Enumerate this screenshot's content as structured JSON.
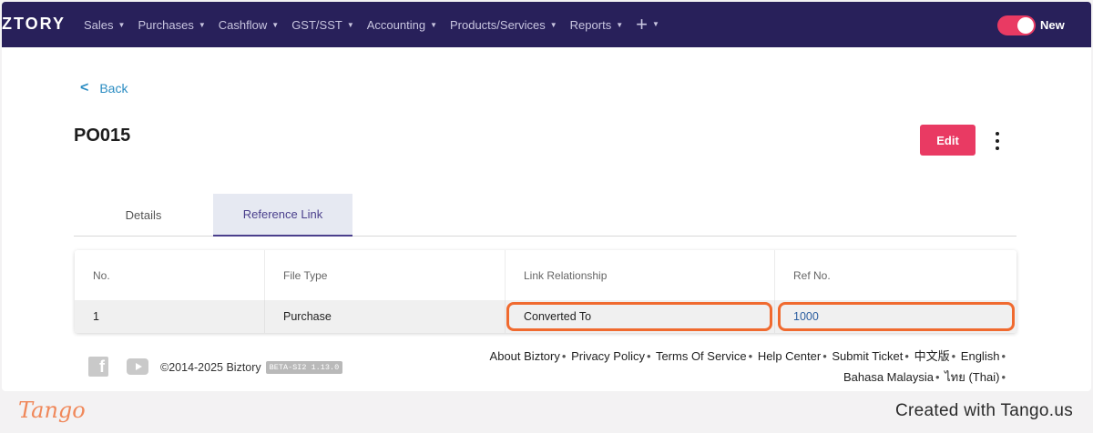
{
  "navbar": {
    "logo": "ZTORY",
    "menu": [
      {
        "label": "Sales"
      },
      {
        "label": "Purchases"
      },
      {
        "label": "Cashflow"
      },
      {
        "label": "GST/SST"
      },
      {
        "label": "Accounting"
      },
      {
        "label": "Products/Services"
      },
      {
        "label": "Reports"
      }
    ],
    "add_icon": "plus-icon",
    "toggle": {
      "label": "New",
      "on": true,
      "color": "#e93a63"
    },
    "background": "#28205a"
  },
  "page": {
    "back_label": "Back",
    "title": "PO015",
    "edit_label": "Edit"
  },
  "tabs": [
    {
      "label": "Details",
      "active": false
    },
    {
      "label": "Reference Link",
      "active": true
    }
  ],
  "table": {
    "headers": [
      "No.",
      "File Type",
      "Link Relationship",
      "Ref No."
    ],
    "rows": [
      {
        "no": "1",
        "file_type": "Purchase",
        "link_relationship": "Converted To",
        "ref_no": "1000"
      }
    ]
  },
  "footer": {
    "copyright": "©2014-2025 Biztory",
    "version": "BETA-SI2 1.13.0",
    "links": [
      "About Biztory",
      "Privacy Policy",
      "Terms Of Service",
      "Help Center",
      "Submit Ticket",
      "中文版",
      "English",
      "Bahasa Malaysia",
      "ไทย (Thai)"
    ],
    "social_icons": [
      "facebook-icon",
      "youtube-icon"
    ]
  },
  "tango": {
    "logo": "Tango",
    "credit": "Created with Tango.us"
  },
  "colors": {
    "accent": "#e93a63",
    "highlight": "#f06a2f",
    "link": "#2a8cc2"
  }
}
